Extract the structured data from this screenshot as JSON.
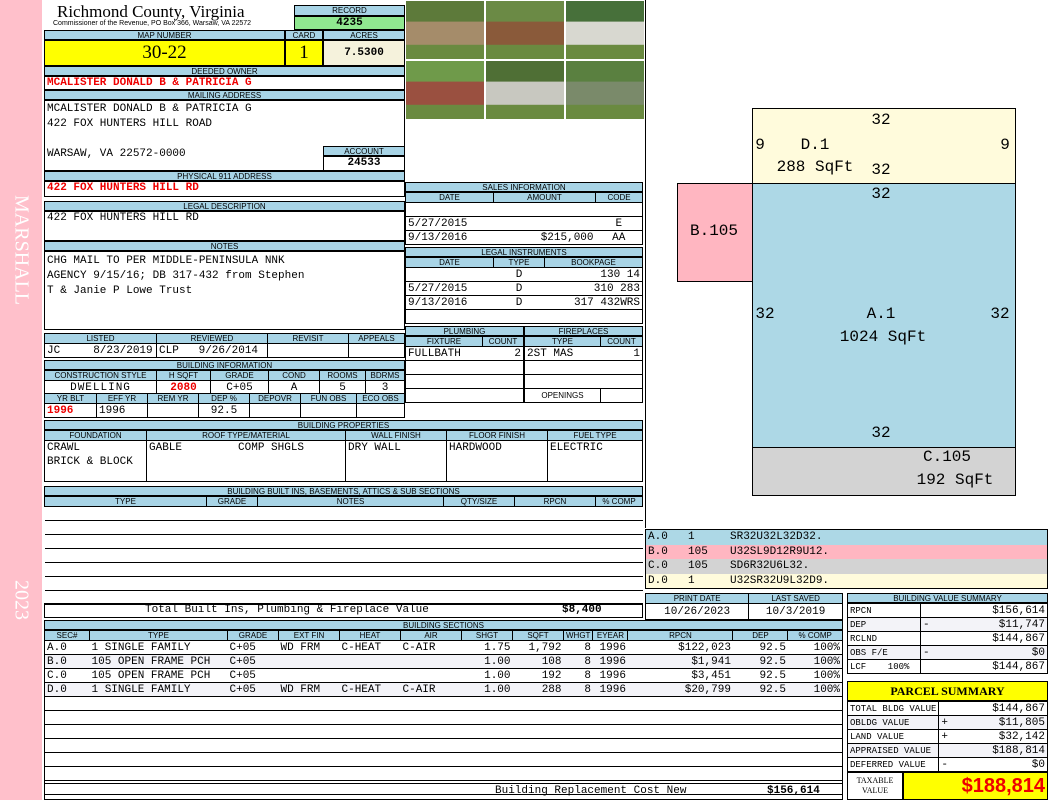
{
  "side": {
    "name": "MARSHALL",
    "year": "2023"
  },
  "header": {
    "title": "Richmond County, Virginia",
    "subtitle": "Commissioner of the Revenue, PO Box 366, Warsaw, VA 22572",
    "record_label": "RECORD",
    "record": "4235"
  },
  "map": {
    "map_label": "MAP NUMBER",
    "map": "30-22",
    "card_label": "CARD",
    "card": "1",
    "acres_label": "ACRES",
    "acres": "7.5300"
  },
  "owner": {
    "label": "DEEDED OWNER",
    "value": "MCALISTER DONALD B & PATRICIA G"
  },
  "mailing": {
    "label": "MAILING ADDRESS",
    "line1": "MCALISTER DONALD B & PATRICIA G",
    "line2": "422 FOX HUNTERS HILL ROAD",
    "line3": "WARSAW, VA 22572-0000",
    "account_label": "ACCOUNT",
    "account": "24533"
  },
  "physical": {
    "label": "PHYSICAL 911 ADDRESS",
    "value": "422 FOX HUNTERS HILL RD"
  },
  "legal": {
    "label": "LEGAL DESCRIPTION",
    "value": "422 FOX HUNTERS HILL RD"
  },
  "notes": {
    "label": "NOTES",
    "line1": "CHG MAIL TO PER MIDDLE-PENINSULA NNK",
    "line2": "AGENCY 9/15/16; DB 317-432 from Stephen",
    "line3": "T & Janie P Lowe Trust"
  },
  "review": {
    "listed_label": "LISTED",
    "listed": "JC     8/23/2019",
    "reviewed_label": "REVIEWED",
    "reviewed": "CLP   9/26/2014",
    "revisit_label": "REVISIT",
    "appeals_label": "APPEALS"
  },
  "bldg_info": {
    "label": "BUILDING INFORMATION",
    "row1_headers": [
      "CONSTRUCTION STYLE",
      "H SQFT",
      "GRADE",
      "COND",
      "ROOMS",
      "BDRMS"
    ],
    "row1": [
      "DWELLING",
      "2080",
      "C+05",
      "A",
      "5",
      "3"
    ],
    "row2_headers": [
      "YR BLT",
      "EFF YR",
      "REM YR",
      "DEP %",
      "DEPOVR",
      "FUN OBS",
      "ECO OBS"
    ],
    "row2": [
      "1996",
      "1996",
      "",
      "92.5",
      "",
      "",
      ""
    ]
  },
  "props": {
    "label": "BUILDING PROPERTIES",
    "headers": [
      "FOUNDATION",
      "ROOF TYPE/MATERIAL",
      "WALL FINISH",
      "FLOOR FINISH",
      "FUEL TYPE"
    ],
    "foundation1": "CRAWL",
    "foundation2": "BRICK & BLOCK",
    "roof1": "GABLE",
    "roof2": "COMP SHGLS",
    "wall": "DRY WALL",
    "floor": "HARDWOOD",
    "fuel": "ELECTRIC"
  },
  "builtins": {
    "label": "BUILDING BUILT INS, BASEMENTS, ATTICS & SUB SECTIONS",
    "headers": [
      "TYPE",
      "GRADE",
      "NOTES",
      "QTY/SIZE",
      "RPCN",
      "% COMP"
    ],
    "total_label": "Total Built Ins, Plumbing & Fireplace Value",
    "total": "$8,400"
  },
  "sales": {
    "label": "SALES INFORMATION",
    "headers": [
      "DATE",
      "AMOUNT",
      "CODE"
    ],
    "rows": [
      [
        "",
        "",
        ""
      ],
      [
        "5/27/2015",
        "",
        "E"
      ],
      [
        "9/13/2016",
        "$215,000",
        "AA"
      ]
    ]
  },
  "instruments": {
    "label": "LEGAL INSTRUMENTS",
    "headers": [
      "DATE",
      "TYPE",
      "BOOKPAGE"
    ],
    "rows": [
      [
        "",
        "D",
        "130 14"
      ],
      [
        "5/27/2015",
        "D",
        "310 283"
      ],
      [
        "9/13/2016",
        "D",
        "317 432WRS"
      ],
      [
        "",
        "",
        ""
      ]
    ]
  },
  "plumbing": {
    "label": "PLUMBING",
    "headers": [
      "FIXTURE",
      "COUNT"
    ],
    "rows": [
      [
        "FULLBATH",
        "2"
      ],
      [
        "",
        ""
      ],
      [
        "",
        ""
      ],
      [
        "",
        ""
      ]
    ]
  },
  "fireplaces": {
    "label": "FIREPLACES",
    "headers": [
      "TYPE",
      "COUNT"
    ],
    "rows": [
      [
        "2ST MAS",
        "1"
      ],
      [
        "",
        ""
      ],
      [
        "",
        ""
      ]
    ],
    "openings_label": "OPENINGS"
  },
  "sketch": {
    "labels": {
      "d_top": "32",
      "d_left": "9",
      "d_name": "D.1",
      "d_right": "9",
      "d_area": "288 SqFt",
      "d_bottom": "32",
      "a_top": "32",
      "b_name": "B.105",
      "a_left": "32",
      "a_name": "A.1",
      "a_right": "32",
      "a_area": "1024 SqFt",
      "a_bottom": "32",
      "c_name": "C.105",
      "c_area": "192 SqFt"
    },
    "vectors": [
      [
        "A.0",
        "1",
        "SR32U32L32D32."
      ],
      [
        "B.0",
        "105",
        "U32SL9D12R9U12."
      ],
      [
        "C.0",
        "105",
        "SD6R32U6L32."
      ],
      [
        "D.0",
        "1",
        "U32SR32U9L32D9."
      ]
    ],
    "colors": {
      "A": "#add8e6",
      "B": "#ffb6c1",
      "C": "#d3d3d3",
      "D": "#fffbdc"
    }
  },
  "dates": {
    "print_label": "PRINT DATE",
    "print": "10/26/2023",
    "saved_label": "LAST SAVED",
    "saved": "10/3/2019"
  },
  "sections": {
    "label": "BUILDING SECTIONS",
    "headers": [
      "SEC#",
      "TYPE",
      "GRADE",
      "EXT FIN",
      "HEAT",
      "AIR",
      "SHGT",
      "SQFT",
      "WHGT",
      "EYEAR",
      "RPCN",
      "DEP",
      "% COMP"
    ],
    "rows": [
      [
        "A.0",
        "1 SINGLE FAMILY",
        "C+05",
        "WD FRM",
        "C-HEAT",
        "C-AIR",
        "1.75",
        "1,792",
        "8",
        "1996",
        "$122,023",
        "92.5",
        "100%"
      ],
      [
        "B.0",
        "105 OPEN FRAME PCH",
        "C+05",
        "",
        "",
        "",
        "1.00",
        "108",
        "8",
        "1996",
        "$1,941",
        "92.5",
        "100%"
      ],
      [
        "C.0",
        "105 OPEN FRAME PCH",
        "C+05",
        "",
        "",
        "",
        "1.00",
        "192",
        "8",
        "1996",
        "$3,451",
        "92.5",
        "100%"
      ],
      [
        "D.0",
        "1 SINGLE FAMILY",
        "C+05",
        "WD FRM",
        "C-HEAT",
        "C-AIR",
        "1.00",
        "288",
        "8",
        "1996",
        "$20,799",
        "92.5",
        "100%"
      ]
    ],
    "total_label": "Building Replacement Cost New",
    "total": "$156,614"
  },
  "value_summary": {
    "label": "BUILDING VALUE SUMMARY",
    "rows": [
      [
        "RPCN",
        "",
        "$156,614"
      ],
      [
        "DEP",
        "-",
        "$11,747"
      ],
      [
        "RCLND",
        "",
        "$144,867"
      ],
      [
        "OBS F/E",
        "-",
        "$0"
      ],
      [
        "LCF    100%",
        "",
        "$144,867"
      ]
    ]
  },
  "parcel": {
    "label": "PARCEL SUMMARY",
    "rows": [
      [
        "TOTAL BLDG VALUE",
        "",
        "$144,867"
      ],
      [
        "OBLDG VALUE",
        "+",
        "$11,805"
      ],
      [
        "LAND VALUE",
        "+",
        "$32,142"
      ],
      [
        "APPRAISED VALUE",
        "",
        "$188,814"
      ],
      [
        "DEFERRED VALUE",
        "-",
        "$0"
      ]
    ],
    "taxable_label": "TAXABLE VALUE",
    "taxable": "$188,814"
  }
}
